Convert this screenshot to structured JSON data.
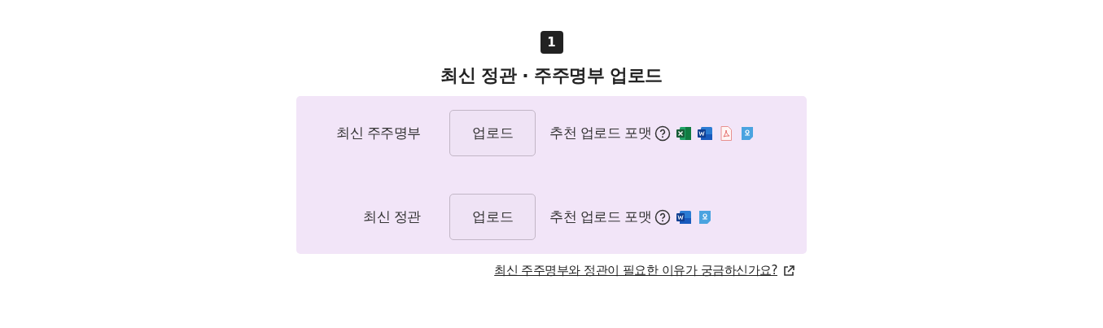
{
  "step_badge": "1",
  "title": "최신 정관 · 주주명부 업로드",
  "rows": [
    {
      "label": "최신 주주명부",
      "button": "업로드",
      "hint": "추천 업로드 포맷",
      "formats": [
        {
          "kind": "excel"
        },
        {
          "kind": "word"
        },
        {
          "kind": "pdf"
        },
        {
          "kind": "hwp"
        }
      ]
    },
    {
      "label": "최신 정관",
      "button": "업로드",
      "hint": "추천 업로드 포맷",
      "formats": [
        {
          "kind": "word"
        },
        {
          "kind": "hwp"
        }
      ]
    }
  ],
  "link": "최신 주주명부와 정관이 필요한 이유가 궁금하신가요?"
}
